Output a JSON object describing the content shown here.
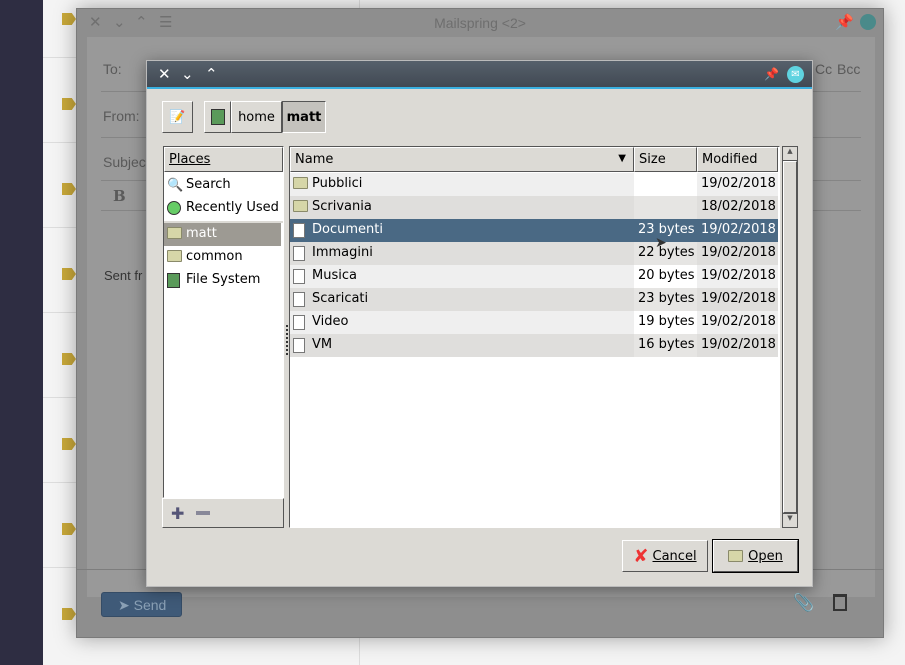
{
  "mail": {
    "title": "Mailspring <2>",
    "to_label": "To:",
    "from_label": "From:",
    "subject_label": "Subject",
    "bold_label": "B",
    "sent_from": "Sent fr",
    "cc": "Cc",
    "bcc": "Bcc",
    "send_label": "Send"
  },
  "dialog": {
    "path": [
      "home",
      "matt"
    ],
    "places_header": "Places",
    "places": [
      {
        "label": "Search",
        "icon": "search-icon"
      },
      {
        "label": "Recently Used",
        "icon": "clock-icon"
      },
      {
        "label": "matt",
        "icon": "folder-icon"
      },
      {
        "label": "common",
        "icon": "folder-icon"
      },
      {
        "label": "File System",
        "icon": "drive-icon"
      }
    ],
    "columns": {
      "name": "Name",
      "size": "Size",
      "modified": "Modified"
    },
    "files": [
      {
        "name": "Pubblici",
        "size": "",
        "modified": "19/02/2018",
        "type": "folder"
      },
      {
        "name": "Scrivania",
        "size": "",
        "modified": "18/02/2018",
        "type": "folder"
      },
      {
        "name": "Documenti",
        "size": "23 bytes",
        "modified": "19/02/2018",
        "type": "file"
      },
      {
        "name": "Immagini",
        "size": "22 bytes",
        "modified": "19/02/2018",
        "type": "file"
      },
      {
        "name": "Musica",
        "size": "20 bytes",
        "modified": "19/02/2018",
        "type": "file"
      },
      {
        "name": "Scaricati",
        "size": "23 bytes",
        "modified": "19/02/2018",
        "type": "file"
      },
      {
        "name": "Video",
        "size": "19 bytes",
        "modified": "19/02/2018",
        "type": "file"
      },
      {
        "name": "VM",
        "size": "16 bytes",
        "modified": "19/02/2018",
        "type": "file"
      }
    ],
    "selected_file": "Documenti",
    "selected_place": "matt",
    "cancel_label": "Cancel",
    "open_label": "Open"
  },
  "colors": {
    "selection": "#4a6984",
    "title_bar": "#4b5561",
    "accent_line": "#3ab0e0"
  }
}
